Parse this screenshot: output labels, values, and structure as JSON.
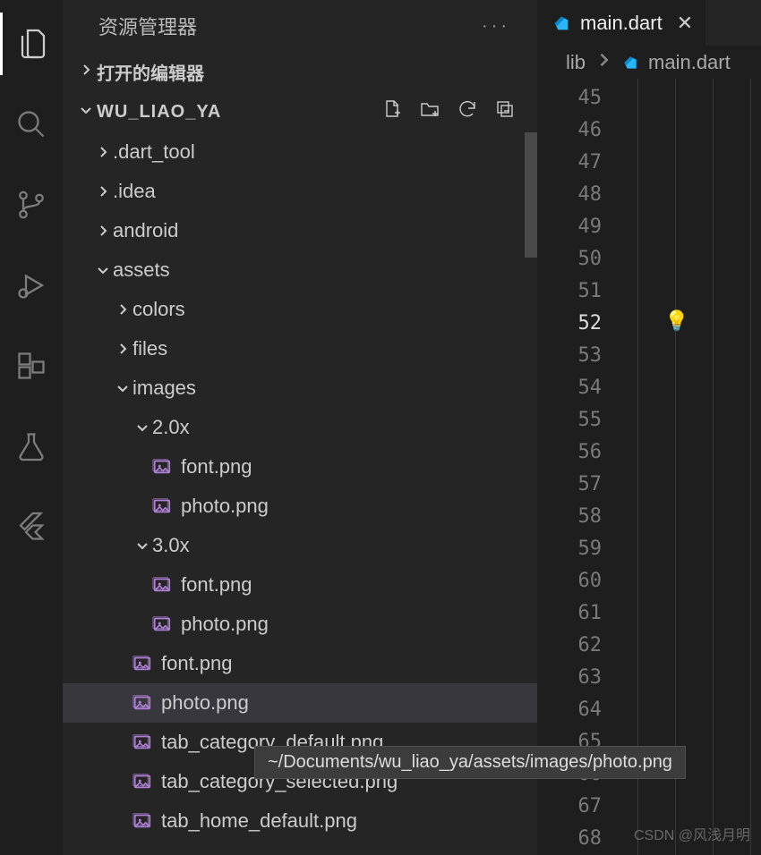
{
  "explorer": {
    "title": "资源管理器",
    "open_editors_label": "打开的编辑器",
    "project_name": "WU_LIAO_YA"
  },
  "tree": [
    {
      "kind": "folder",
      "state": "closed",
      "depth": 0,
      "name": ".dart_tool"
    },
    {
      "kind": "folder",
      "state": "closed",
      "depth": 0,
      "name": ".idea"
    },
    {
      "kind": "folder",
      "state": "closed",
      "depth": 0,
      "name": "android"
    },
    {
      "kind": "folder",
      "state": "open",
      "depth": 0,
      "name": "assets"
    },
    {
      "kind": "folder",
      "state": "closed",
      "depth": 1,
      "name": "colors"
    },
    {
      "kind": "folder",
      "state": "closed",
      "depth": 1,
      "name": "files"
    },
    {
      "kind": "folder",
      "state": "open",
      "depth": 1,
      "name": "images"
    },
    {
      "kind": "folder",
      "state": "open",
      "depth": 2,
      "name": "2.0x"
    },
    {
      "kind": "file",
      "icon": "image",
      "depth": 3,
      "name": "font.png"
    },
    {
      "kind": "file",
      "icon": "image",
      "depth": 3,
      "name": "photo.png"
    },
    {
      "kind": "folder",
      "state": "open",
      "depth": 2,
      "name": "3.0x"
    },
    {
      "kind": "file",
      "icon": "image",
      "depth": 3,
      "name": "font.png"
    },
    {
      "kind": "file",
      "icon": "image",
      "depth": 3,
      "name": "photo.png"
    },
    {
      "kind": "file",
      "icon": "image",
      "depth": 2,
      "name": "font.png"
    },
    {
      "kind": "file",
      "icon": "image",
      "depth": 2,
      "name": "photo.png",
      "selected": true
    },
    {
      "kind": "file",
      "icon": "image",
      "depth": 2,
      "name": "tab_category_default.png"
    },
    {
      "kind": "file",
      "icon": "image",
      "depth": 2,
      "name": "tab_category_selected.png"
    },
    {
      "kind": "file",
      "icon": "image",
      "depth": 2,
      "name": "tab_home_default.png"
    }
  ],
  "tooltip_path": "~/Documents/wu_liao_ya/assets/images/photo.png",
  "tabs": [
    {
      "label": "main.dart",
      "icon": "dart",
      "active": true
    }
  ],
  "breadcrumb": {
    "folder": "lib",
    "file": "main.dart"
  },
  "line_numbers": [
    45,
    46,
    47,
    48,
    49,
    50,
    51,
    52,
    53,
    54,
    55,
    56,
    57,
    58,
    59,
    60,
    61,
    62,
    63,
    64,
    65,
    66,
    67,
    68
  ],
  "active_line": 52,
  "bulb": "💡",
  "watermark": "CSDN @风浅月明"
}
